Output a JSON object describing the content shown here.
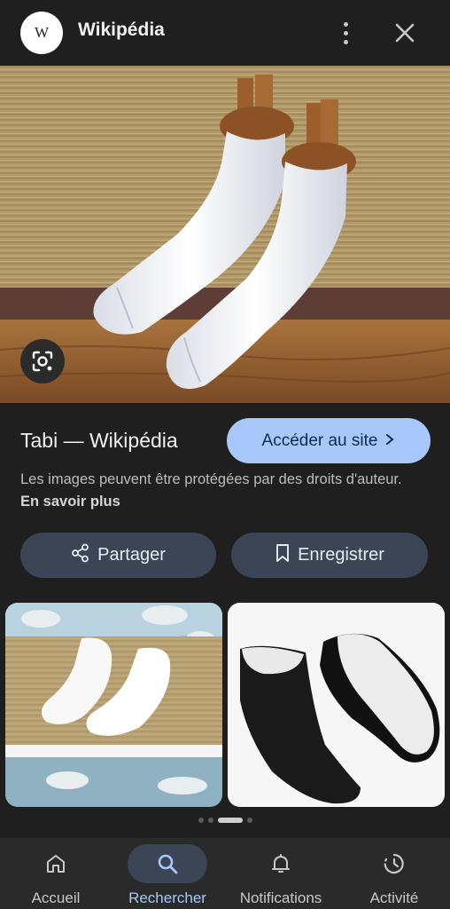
{
  "header": {
    "logo_letter": "W",
    "site_name": "Wikipédia"
  },
  "result": {
    "title": "Tabi — Wikipédia",
    "visit_label": "Accéder au site",
    "copyright_text": "Les images peuvent être protégées par des droits d'auteur.",
    "learn_more": "En savoir plus"
  },
  "actions": {
    "share_label": "Partager",
    "save_label": "Enregistrer"
  },
  "pager": {
    "count": 4,
    "active_index": 2
  },
  "bottom_nav": {
    "items": [
      {
        "label": "Accueil",
        "icon": "home-icon"
      },
      {
        "label": "Rechercher",
        "icon": "search-icon",
        "active": true
      },
      {
        "label": "Notifications",
        "icon": "bell-icon"
      },
      {
        "label": "Activité",
        "icon": "history-icon"
      }
    ]
  },
  "colors": {
    "background": "#1f1f1f",
    "accent": "#a8c7fa",
    "button_bg": "#3c4556"
  }
}
